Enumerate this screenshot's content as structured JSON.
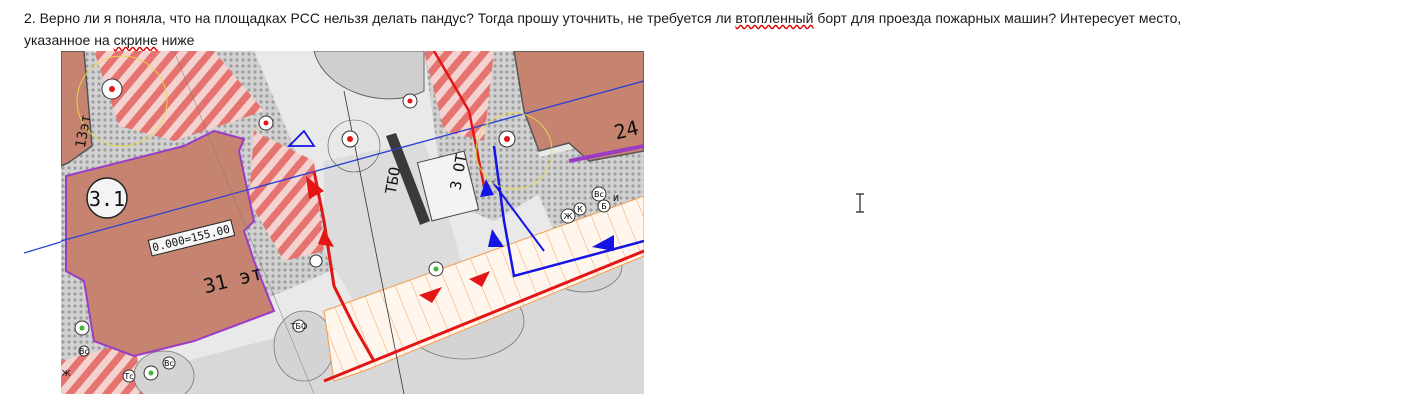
{
  "question": {
    "part_before": "2. Верно ли я поняла, что на площадках РСС нельзя делать пандус? Тогда прошу уточнить, не требуется ли ",
    "misspelled": "втопленный",
    "part_middle": " борт для проезда пожарных машин? Интересует место,",
    "line2_start": "указанное  на ",
    "misspelled2": "скрине",
    "line2_end": " ниже"
  },
  "plan": {
    "building_label": "3.1",
    "building_elevation": "0.000=155.00",
    "building_floors": "31 эт",
    "building_right_number": "24",
    "building_left_floors": "13эт",
    "area_label_1": "ТБО",
    "area_label_2": "3 ОТ",
    "marker_labels": [
      "Вс",
      "Ж",
      "К",
      "Вс",
      "Вс",
      "Тс",
      "ТБО",
      "Б",
      "Ж",
      "И"
    ]
  },
  "colors": {
    "building_fill": "#c68470",
    "building_edge": "#9b3cc7",
    "paving": "#cfcfcf",
    "hatch_red": "#e0524f",
    "fire_route": "#e31515",
    "blue_route": "#1414e6",
    "orange_line": "#f39a4a"
  },
  "icons": {
    "cursor": "text-cursor-icon"
  }
}
